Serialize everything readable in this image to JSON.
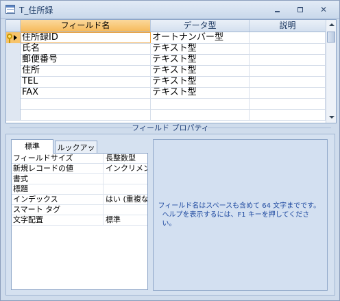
{
  "window": {
    "title": "T_住所録"
  },
  "grid": {
    "columns": [
      "フィールド名",
      "データ型",
      "説明"
    ],
    "rows": [
      {
        "name": "住所録ID",
        "type": "オートナンバー型",
        "desc": ""
      },
      {
        "name": "氏名",
        "type": "テキスト型",
        "desc": ""
      },
      {
        "name": "郵便番号",
        "type": "テキスト型",
        "desc": ""
      },
      {
        "name": "住所",
        "type": "テキスト型",
        "desc": ""
      },
      {
        "name": "TEL",
        "type": "テキスト型",
        "desc": ""
      },
      {
        "name": "FAX",
        "type": "テキスト型",
        "desc": ""
      },
      {
        "name": "",
        "type": "",
        "desc": ""
      },
      {
        "name": "",
        "type": "",
        "desc": ""
      }
    ]
  },
  "properties": {
    "band_label": "フィールド プロパティ",
    "tabs": [
      "標準",
      "ルックアップ"
    ],
    "rows": [
      {
        "label": "フィールドサイズ",
        "value": "長整数型"
      },
      {
        "label": "新規レコードの値",
        "value": "インクリメント"
      },
      {
        "label": "書式",
        "value": ""
      },
      {
        "label": "標題",
        "value": ""
      },
      {
        "label": "インデックス",
        "value": "はい (重複なし)"
      },
      {
        "label": "スマート タグ",
        "value": ""
      },
      {
        "label": "文字配置",
        "value": "標準"
      }
    ],
    "help_line1": "フィールド名はスペースも含めて 64 文字までです。",
    "help_line2": "ヘルプを表示するには、F1 キーを押してください。"
  }
}
